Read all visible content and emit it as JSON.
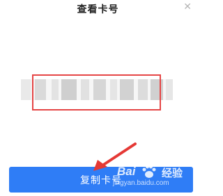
{
  "dialog": {
    "title": "查看卡号",
    "close_icon": "close-icon",
    "copy_button_label": "复制卡号"
  },
  "watermark": {
    "brand": "Bai",
    "suffix": "经验",
    "url": "jingyan.baidu.com"
  },
  "colors": {
    "primary": "#2f7df6",
    "highlight": "#e54545"
  }
}
